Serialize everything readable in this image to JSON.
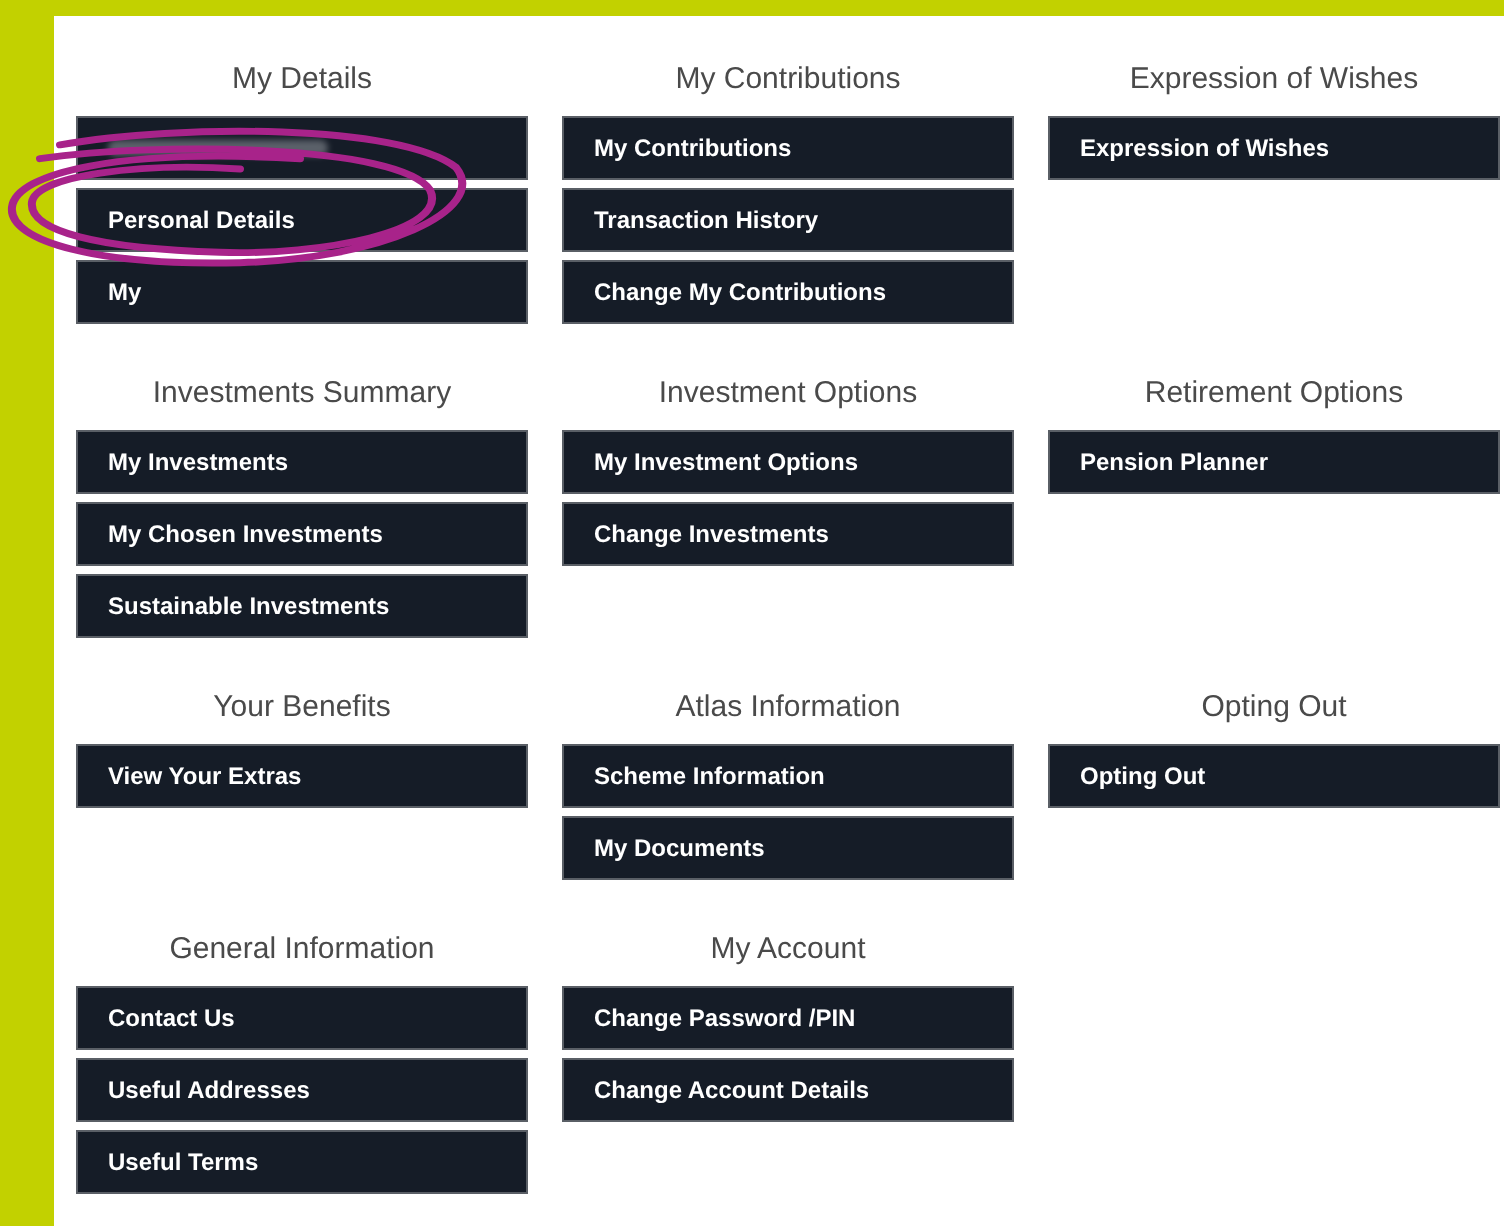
{
  "sections": [
    {
      "title": "My Details",
      "buttons": [
        {
          "kind": "obscured"
        },
        {
          "label": "Personal Details"
        },
        {
          "label": "My"
        }
      ]
    },
    {
      "title": "My Contributions",
      "buttons": [
        {
          "label": "My Contributions"
        },
        {
          "label": "Transaction History"
        },
        {
          "label": "Change My Contributions"
        }
      ]
    },
    {
      "title": "Expression of Wishes",
      "buttons": [
        {
          "label": "Expression of Wishes"
        }
      ]
    },
    {
      "title": "Investments Summary",
      "buttons": [
        {
          "label": "My Investments"
        },
        {
          "label": "My Chosen Investments"
        },
        {
          "label": "Sustainable Investments"
        }
      ]
    },
    {
      "title": "Investment Options",
      "buttons": [
        {
          "label": "My Investment Options"
        },
        {
          "label": "Change Investments"
        }
      ]
    },
    {
      "title": "Retirement Options",
      "buttons": [
        {
          "label": "Pension Planner"
        }
      ]
    },
    {
      "title": "Your Benefits",
      "buttons": [
        {
          "label": "View Your Extras"
        }
      ]
    },
    {
      "title": "Atlas Information",
      "buttons": [
        {
          "label": "Scheme Information"
        },
        {
          "label": "My Documents"
        }
      ]
    },
    {
      "title": "Opting Out",
      "buttons": [
        {
          "label": "Opting Out"
        }
      ]
    },
    {
      "title": "General Information",
      "buttons": [
        {
          "label": "Contact Us"
        },
        {
          "label": "Useful Addresses"
        },
        {
          "label": "Useful Terms"
        }
      ]
    },
    {
      "title": "My Account",
      "buttons": [
        {
          "label": "Change Password /PIN"
        },
        {
          "label": "Change Account Details"
        }
      ]
    }
  ]
}
